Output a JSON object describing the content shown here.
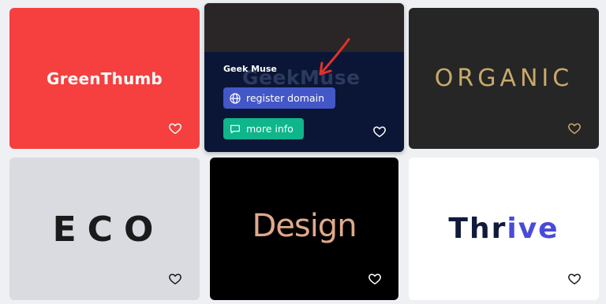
{
  "cards": [
    {
      "logo": "GreenThumb",
      "bg": "#f5403f",
      "text_color": "#ffffff",
      "favorite_icon": "heart-icon"
    },
    {
      "logo_ghost": "GeekMuse",
      "name": "Geek Muse",
      "bg": "#0b1636",
      "register_label": "register domain",
      "register_icon": "globe-icon",
      "info_label": "more info",
      "info_icon": "chat-bubble-icon",
      "register_color": "#4457c7",
      "info_color": "#0fb58b",
      "annotation": "red-arrow",
      "favorite_icon": "heart-icon"
    },
    {
      "logo": "ORGANIC",
      "bg": "#262626",
      "text_color": "#c8a96a",
      "favorite_icon": "heart-icon"
    },
    {
      "logo": "ECO",
      "bg": "#d9dbe0",
      "text_color": "#1b1b1b",
      "favorite_icon": "heart-icon"
    },
    {
      "logo": "Design",
      "bg": "#000000",
      "text_color": "#e0a98a",
      "favorite_icon": "heart-icon"
    },
    {
      "logo_part1": "Thr",
      "logo_part2": "ive",
      "bg": "#ffffff",
      "text_color": "#111a3a",
      "accent_color": "#4a4ad8",
      "favorite_icon": "heart-icon"
    }
  ]
}
